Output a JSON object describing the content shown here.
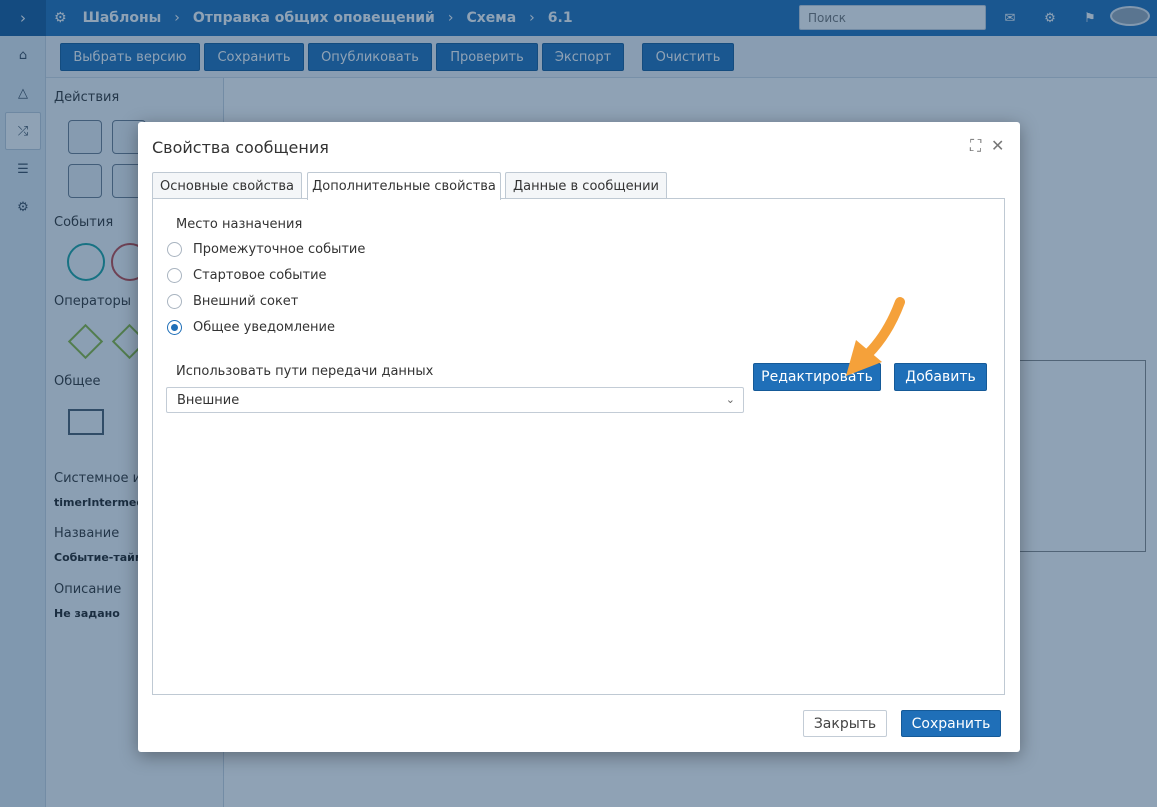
{
  "topbar": {
    "breadcrumbs": [
      "Шаблоны",
      "Отправка общих оповещений",
      "Схема",
      "6.1"
    ],
    "search_placeholder": "Поиск"
  },
  "toolbar": {
    "buttons": [
      "Выбрать версию",
      "Сохранить",
      "Опубликовать",
      "Проверить",
      "Экспорт",
      "Очистить"
    ]
  },
  "palette": {
    "sections": [
      "Действия",
      "События",
      "Операторы",
      "Общее"
    ],
    "properties": [
      {
        "label": "Системное им",
        "value": "timerIntermedi"
      },
      {
        "label": "Название",
        "value": "Событие-тайме"
      },
      {
        "label": "Описание",
        "value": "Не задано"
      }
    ]
  },
  "dialog": {
    "title": "Свойства сообщения",
    "tabs": [
      "Основные свойства",
      "Дополнительные свойства",
      "Данные в сообщении"
    ],
    "active_tab": "Дополнительные свойства",
    "destination_label": "Место назначения",
    "destination_options": [
      "Промежуточное событие",
      "Стартовое событие",
      "Внешний сокет",
      "Общее уведомление"
    ],
    "destination_selected": "Общее уведомление",
    "data_paths_label": "Использовать пути передачи данных",
    "data_paths_value": "Внешние",
    "edit_button": "Редактировать",
    "add_button": "Добавить",
    "close_button": "Закрыть",
    "save_button": "Сохранить"
  },
  "colors": {
    "primary": "#1f6fb8",
    "annotation_arrow": "#f5a13a"
  }
}
